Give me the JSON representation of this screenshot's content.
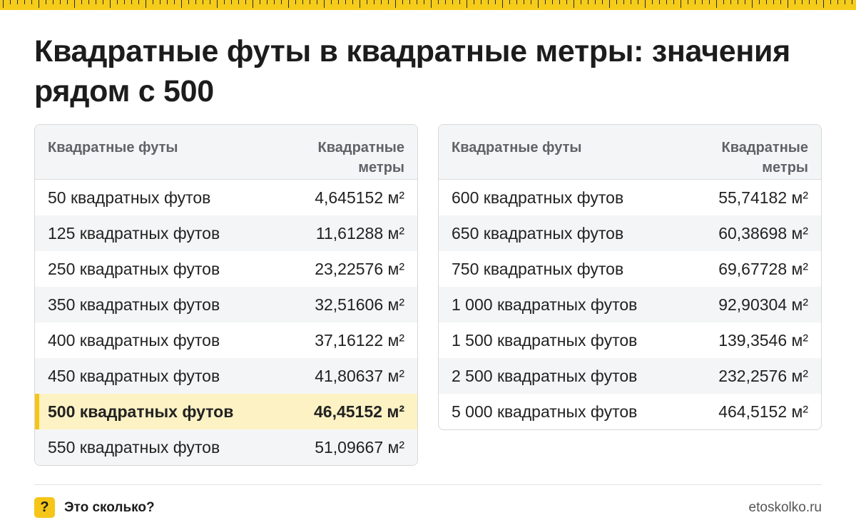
{
  "title": "Квадратные футы в квадратные метры: значения рядом с 500",
  "colors": {
    "accent": "#f5c518",
    "highlight_row": "#fdf2c4",
    "stripe": "#f4f5f6"
  },
  "left_table": {
    "headers": [
      "Квадратные футы",
      "Квадратные метры"
    ],
    "rows": [
      {
        "sqft": "50 квадратных футов",
        "sqm": "4,645152 м²"
      },
      {
        "sqft": "125 квадратных футов",
        "sqm": "11,61288 м²"
      },
      {
        "sqft": "250 квадратных футов",
        "sqm": "23,22576 м²"
      },
      {
        "sqft": "350 квадратных футов",
        "sqm": "32,51606 м²"
      },
      {
        "sqft": "400 квадратных футов",
        "sqm": "37,16122 м²"
      },
      {
        "sqft": "450 квадратных футов",
        "sqm": "41,80637 м²"
      },
      {
        "sqft": "500 квадратных футов",
        "sqm": "46,45152 м²",
        "highlighted": true
      },
      {
        "sqft": "550 квадратных футов",
        "sqm": "51,09667 м²"
      }
    ]
  },
  "right_table": {
    "headers": [
      "Квадратные футы",
      "Квадратные метры"
    ],
    "rows": [
      {
        "sqft": "600 квадратных футов",
        "sqm": "55,74182 м²"
      },
      {
        "sqft": "650 квадратных футов",
        "sqm": "60,38698 м²"
      },
      {
        "sqft": "750 квадратных футов",
        "sqm": "69,67728 м²"
      },
      {
        "sqft": "1 000 квадратных футов",
        "sqm": "92,90304 м²"
      },
      {
        "sqft": "1 500 квадратных футов",
        "sqm": "139,3546 м²"
      },
      {
        "sqft": "2 500 квадратных футов",
        "sqm": "232,2576 м²"
      },
      {
        "sqft": "5 000 квадратных футов",
        "sqm": "464,5152 м²"
      }
    ]
  },
  "footer": {
    "badge_icon": "question-mark-icon",
    "badge_text": "?",
    "brand": "Это сколько?",
    "site": "etoskolko.ru"
  }
}
